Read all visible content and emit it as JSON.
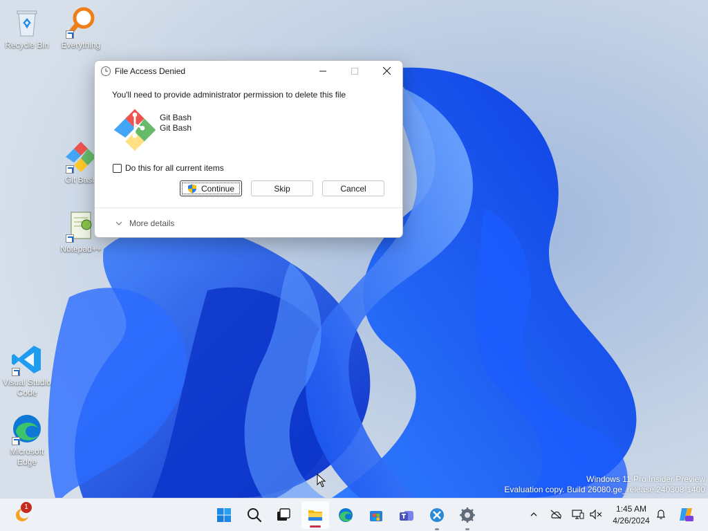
{
  "desktop": {
    "icons": [
      {
        "label": "Recycle Bin"
      },
      {
        "label": "Everything"
      },
      {
        "label": "Git Bash"
      },
      {
        "label": "Notepad++"
      },
      {
        "label": "Visual Studio Code"
      },
      {
        "label": "Microsoft Edge"
      }
    ],
    "watermark_line1": "Windows 11 Pro Insider Preview",
    "watermark_line2": "Evaluation copy. Build 26080.ge_release.240308-1400"
  },
  "dialog": {
    "title": "File Access Denied",
    "message": "You'll need to provide administrator permission to delete this file",
    "file_name": "Git Bash",
    "file_description": "Git Bash",
    "checkbox_label": "Do this for all current items",
    "checkbox_checked": false,
    "continue_label": "Continue",
    "skip_label": "Skip",
    "cancel_label": "Cancel",
    "more_details_label": "More details"
  },
  "taskbar": {
    "widgets_badge": "1",
    "apps": [
      "start-icon",
      "search-icon",
      "task-view-icon",
      "file-explorer-icon",
      "edge-icon",
      "store-icon",
      "teams-icon",
      "snipping-icon",
      "settings-icon"
    ],
    "clock_time": "1:45 AM",
    "clock_date": "4/26/2024"
  },
  "colors": {
    "accent": "#0067c0",
    "badge": "#c42b1c",
    "active_indicator": "#c4314b"
  }
}
